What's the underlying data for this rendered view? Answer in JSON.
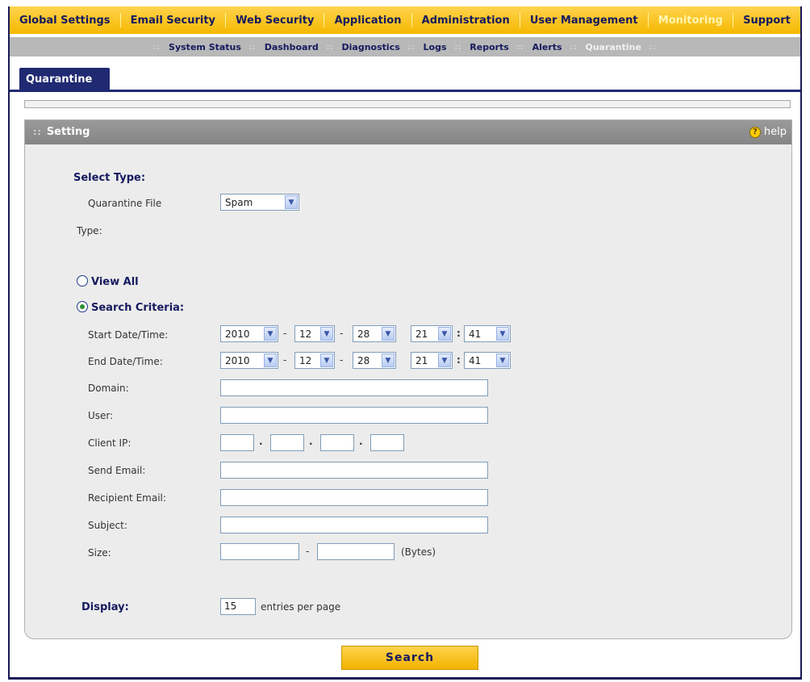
{
  "topnav": {
    "items": [
      "Global Settings",
      "Email Security",
      "Web Security",
      "Application",
      "Administration",
      "User Management",
      "Monitoring",
      "Support"
    ],
    "active": "Monitoring"
  },
  "subnav": {
    "items": [
      "System Status",
      "Dashboard",
      "Diagnostics",
      "Logs",
      "Reports",
      "Alerts",
      "Quarantine"
    ],
    "active": "Quarantine"
  },
  "tab": {
    "label": "Quarantine"
  },
  "panel": {
    "title": "Setting",
    "help_label": "help",
    "help_icon": "question-circle-icon"
  },
  "form": {
    "select_type_label": "Select Type:",
    "quarantine_file_label": "Quarantine File",
    "quarantine_file_value": "Spam",
    "type_label": "Type:",
    "view_all_label": "View All",
    "view_all_selected": false,
    "search_criteria_label": "Search Criteria:",
    "search_criteria_selected": true,
    "start_label": "Start Date/Time:",
    "start": {
      "year": "2010",
      "month": "12",
      "day": "28",
      "hour": "21",
      "minute": "41"
    },
    "end_label": "End Date/Time:",
    "end": {
      "year": "2010",
      "month": "12",
      "day": "28",
      "hour": "21",
      "minute": "41"
    },
    "date_sep": "-",
    "time_sep": ":",
    "ip_sep": ".",
    "domain_label": "Domain:",
    "domain_value": "",
    "user_label": "User:",
    "user_value": "",
    "client_ip_label": "Client IP:",
    "client_ip": [
      "",
      "",
      "",
      ""
    ],
    "send_email_label": "Send Email:",
    "send_email_value": "",
    "recipient_email_label": "Recipient Email:",
    "recipient_email_value": "",
    "subject_label": "Subject:",
    "subject_value": "",
    "size_label": "Size:",
    "size_min": "",
    "size_max": "",
    "size_sep": "-",
    "size_unit": "(Bytes)",
    "display_label": "Display:",
    "display_value": "15",
    "display_suffix": "entries per page"
  },
  "search_button": {
    "label": "Search"
  },
  "colors": {
    "nav_yellow": "#f5b800",
    "nav_text": "#151a5e",
    "tab_blue": "#1f2a72",
    "panel_gray": "#ececec",
    "header_gray": "#858585"
  }
}
